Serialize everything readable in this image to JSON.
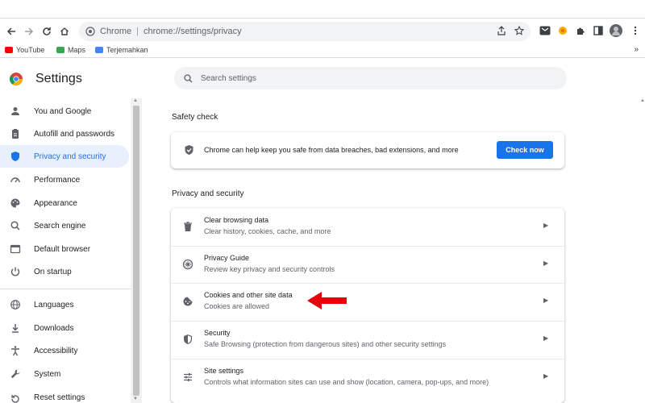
{
  "browser": {
    "omnibox_chip": "Chrome",
    "url": "chrome://settings/privacy",
    "bookmarks": [
      {
        "label": "YouTube",
        "color": "#ff0000"
      },
      {
        "label": "Maps",
        "color": "#34a853"
      },
      {
        "label": "Terjemahkan",
        "color": "#4285f4"
      }
    ],
    "more_bookmarks": "»"
  },
  "header": {
    "title": "Settings",
    "search_placeholder": "Search settings"
  },
  "sidebar": {
    "items": [
      {
        "label": "You and Google",
        "icon": "person-icon"
      },
      {
        "label": "Autofill and passwords",
        "icon": "clipboard-icon"
      },
      {
        "label": "Privacy and security",
        "icon": "shield-icon",
        "active": true
      },
      {
        "label": "Performance",
        "icon": "speedometer-icon"
      },
      {
        "label": "Appearance",
        "icon": "palette-icon"
      },
      {
        "label": "Search engine",
        "icon": "search-icon"
      },
      {
        "label": "Default browser",
        "icon": "browser-icon"
      },
      {
        "label": "On startup",
        "icon": "power-icon"
      },
      {
        "label": "Languages",
        "icon": "globe-icon"
      },
      {
        "label": "Downloads",
        "icon": "download-icon"
      },
      {
        "label": "Accessibility",
        "icon": "accessibility-icon"
      },
      {
        "label": "System",
        "icon": "wrench-icon"
      }
    ],
    "partial_item": "Reset settings"
  },
  "main": {
    "safety_check": {
      "title": "Safety check",
      "text": "Chrome can help keep you safe from data breaches, bad extensions, and more",
      "button": "Check now"
    },
    "privacy": {
      "title": "Privacy and security",
      "rows": [
        {
          "title": "Clear browsing data",
          "subtitle": "Clear history, cookies, cache, and more",
          "icon": "trash-icon"
        },
        {
          "title": "Privacy Guide",
          "subtitle": "Review key privacy and security controls",
          "icon": "compass-icon"
        },
        {
          "title": "Cookies and other site data",
          "subtitle": "Cookies are allowed",
          "icon": "cookie-icon"
        },
        {
          "title": "Security",
          "subtitle": "Safe Browsing (protection from dangerous sites) and other security settings",
          "icon": "shield-icon"
        },
        {
          "title": "Site settings",
          "subtitle": "Controls what information sites can use and show (location, camera, pop-ups, and more)",
          "icon": "sliders-icon"
        }
      ]
    }
  },
  "colors": {
    "accent": "#1a73e8",
    "active_bg": "#e8f0fe",
    "annotation_arrow": "#e8000b"
  }
}
